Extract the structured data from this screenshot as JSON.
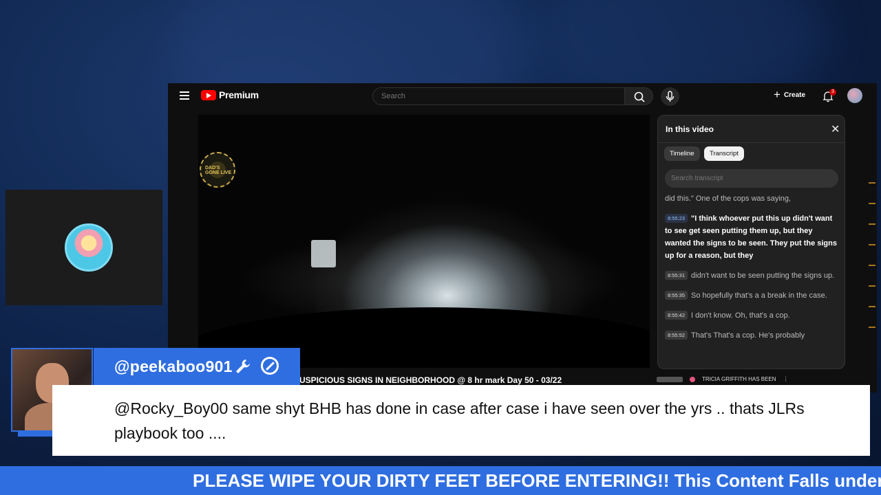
{
  "youtube": {
    "logo_text": "Premium",
    "search_placeholder": "Search",
    "create_label": "Create",
    "notification_count": "3",
    "video_title": "USPICIOUS SIGNS IN NEIGHBORHOOD @ 8 hr mark Day 50 - 03/22",
    "related_title": "TRICIA GRIFFITH HAS BEEN",
    "channel_logo_text": "DAD'S GONE LIVE"
  },
  "panel": {
    "title": "In this video",
    "close_icon": "✕",
    "tabs": [
      "Timeline",
      "Transcript"
    ],
    "active_tab": "Transcript",
    "search_placeholder": "Search transcript",
    "items": [
      {
        "time": "",
        "text": "did this.\" One of the cops was saying,"
      },
      {
        "time": "8:55:23",
        "text": "\"I think whoever put this up didn't want to see get seen putting them up, but they wanted the signs to be seen. They put the signs up for a reason, but they",
        "active": true
      },
      {
        "time": "8:55:31",
        "text": "didn't want to be seen putting the signs up."
      },
      {
        "time": "8:55:35",
        "text": "So hopefully that's a a break in the case."
      },
      {
        "time": "8:55:42",
        "text": "I don't know. Oh, that's a cop."
      },
      {
        "time": "8:55:52",
        "text": "That's That's a cop. He's probably"
      }
    ]
  },
  "chat": {
    "username": "@peekaboo901",
    "message": "@Rocky_Boy00 same shyt BHB has done in case after case i have seen over the yrs .. thats JLRs playbook too ...."
  },
  "ticker": {
    "text": "PLEASE WIPE YOUR DIRTY FEET BEFORE ENTERING!! This Content Falls under the"
  },
  "colors": {
    "accent_blue": "#2f6ee0",
    "youtube_red": "#ff0000",
    "background": "#0f0f0f"
  }
}
